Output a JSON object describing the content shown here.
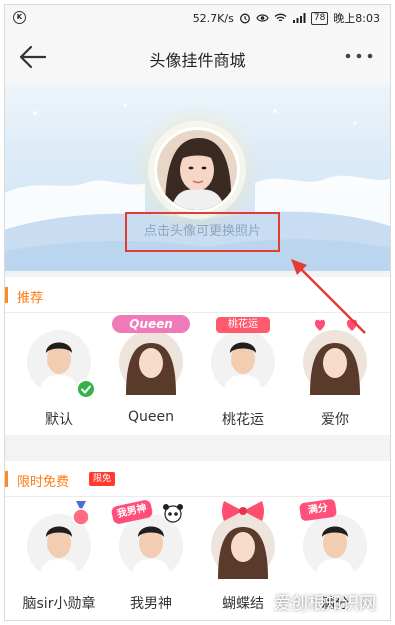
{
  "status_bar": {
    "network_speed": "52.7K/s",
    "battery": "78",
    "time": "晚上8:03"
  },
  "header": {
    "title": "头像挂件商城",
    "more_label": "···"
  },
  "profile": {
    "change_photo_hint": "点击头像可更换照片"
  },
  "sections": [
    {
      "title": "推荐",
      "items": [
        {
          "name": "默认",
          "selected": true
        },
        {
          "name": "Queen",
          "pendant_text": "Queen"
        },
        {
          "name": "桃花运",
          "pendant_text": "桃花运"
        },
        {
          "name": "爱你"
        }
      ]
    },
    {
      "title": "限时免费",
      "tag": "限免",
      "items": [
        {
          "name": "脑sir小勋章"
        },
        {
          "name": "我男神",
          "pendant_text": "我男神"
        },
        {
          "name": "蝴蝶结"
        },
        {
          "name": "满分",
          "pendant_text": "满分"
        }
      ]
    }
  ],
  "watermark": "爱创根知识网",
  "colors": {
    "accent_orange": "#ff7a12",
    "highlight_red": "#e33b36",
    "check_green": "#35b34a"
  }
}
